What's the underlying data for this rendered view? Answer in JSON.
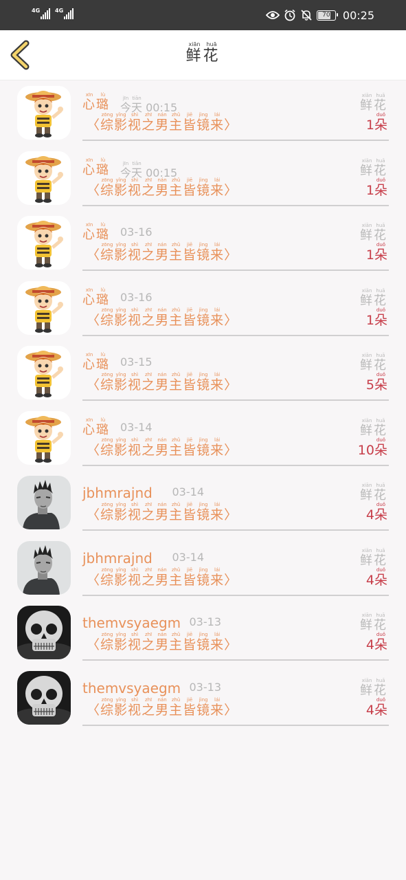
{
  "status_bar": {
    "signal1": "4G",
    "signal2": "4G",
    "battery": "70",
    "time": "00:25"
  },
  "header": {
    "title": [
      {
        "char": "鲜",
        "pinyin": "xiān"
      },
      {
        "char": "花",
        "pinyin": "huā"
      }
    ],
    "back_icon": "chevron-left-icon"
  },
  "common": {
    "book_title": [
      {
        "char": "〈",
        "pinyin": ""
      },
      {
        "char": "综",
        "pinyin": "zōng"
      },
      {
        "char": "影",
        "pinyin": "yǐng"
      },
      {
        "char": "视",
        "pinyin": "shì"
      },
      {
        "char": "之",
        "pinyin": "zhī"
      },
      {
        "char": "男",
        "pinyin": "nán"
      },
      {
        "char": "主",
        "pinyin": "zhǔ"
      },
      {
        "char": "皆",
        "pinyin": "jiē"
      },
      {
        "char": "镜",
        "pinyin": "jìng"
      },
      {
        "char": "来",
        "pinyin": "lái"
      },
      {
        "char": "〉",
        "pinyin": ""
      }
    ],
    "gift_name": [
      {
        "char": "鲜",
        "pinyin": "xiān"
      },
      {
        "char": "花",
        "pinyin": "huā"
      }
    ],
    "unit": {
      "char": "朵",
      "pinyin": "duǒ"
    }
  },
  "records": [
    {
      "avatar": "cartoon-boy-straw-hat",
      "name": "心璐",
      "name_pinyin": [
        "xīn",
        "lù"
      ],
      "time": "00:15",
      "time_prefix": [
        {
          "char": "今",
          "pinyin": "jīn"
        },
        {
          "char": "天",
          "pinyin": "tiān"
        }
      ],
      "count": "1"
    },
    {
      "avatar": "cartoon-boy-straw-hat",
      "name": "心璐",
      "name_pinyin": [
        "xīn",
        "lù"
      ],
      "time": "00:15",
      "time_prefix": [
        {
          "char": "今",
          "pinyin": "jīn"
        },
        {
          "char": "天",
          "pinyin": "tiān"
        }
      ],
      "count": "1"
    },
    {
      "avatar": "cartoon-boy-straw-hat",
      "name": "心璐",
      "name_pinyin": [
        "xīn",
        "lù"
      ],
      "time": "03-16",
      "time_prefix": [],
      "count": "1"
    },
    {
      "avatar": "cartoon-boy-straw-hat",
      "name": "心璐",
      "name_pinyin": [
        "xīn",
        "lù"
      ],
      "time": "03-16",
      "time_prefix": [],
      "count": "1"
    },
    {
      "avatar": "cartoon-boy-straw-hat",
      "name": "心璐",
      "name_pinyin": [
        "xīn",
        "lù"
      ],
      "time": "03-15",
      "time_prefix": [],
      "count": "5"
    },
    {
      "avatar": "cartoon-boy-straw-hat",
      "name": "心璐",
      "name_pinyin": [
        "xīn",
        "lù"
      ],
      "time": "03-14",
      "time_prefix": [],
      "count": "10"
    },
    {
      "avatar": "man-portrait-gray",
      "name": "jbhmrajnd",
      "name_pinyin": [],
      "time": "03-14",
      "time_prefix": [],
      "count": "4"
    },
    {
      "avatar": "man-portrait-gray",
      "name": "jbhmrajnd",
      "name_pinyin": [],
      "time": "03-14",
      "time_prefix": [],
      "count": "4"
    },
    {
      "avatar": "skull",
      "name": "themvsyaegm",
      "name_pinyin": [],
      "time": "03-13",
      "time_prefix": [],
      "count": "4"
    },
    {
      "avatar": "skull",
      "name": "themvsyaegm",
      "name_pinyin": [],
      "time": "03-13",
      "time_prefix": [],
      "count": "4"
    }
  ]
}
